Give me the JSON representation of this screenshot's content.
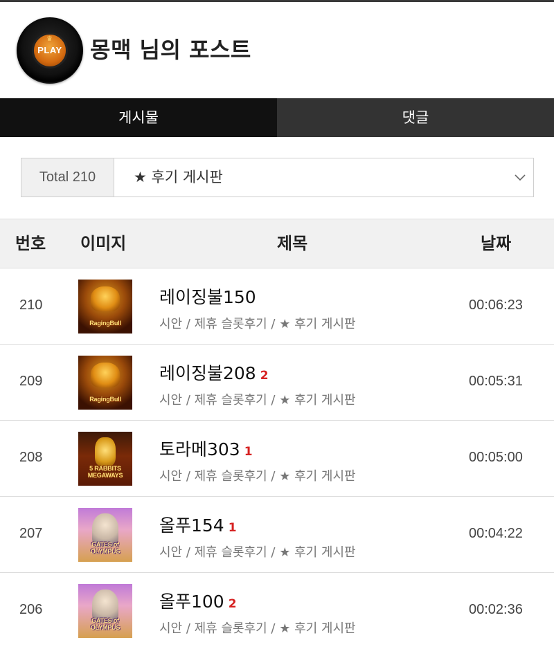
{
  "header": {
    "avatar_text": "PLAY",
    "title": "몽맥 님의 포스트"
  },
  "tabs": [
    {
      "label": "게시물",
      "active": true
    },
    {
      "label": "댓글",
      "active": false
    }
  ],
  "filter": {
    "total_label": "Total 210",
    "selected_board": "★ 후기 게시판"
  },
  "table": {
    "headers": {
      "number": "번호",
      "image": "이미지",
      "title": "제목",
      "date": "날짜"
    },
    "rows": [
      {
        "number": "210",
        "thumb": "raging-bull",
        "thumb_label": "RagingBull",
        "title": "레이징불150",
        "comments": "",
        "meta": "시안 / 제휴 슬롯후기 / ★ 후기 게시판",
        "date": "00:06:23"
      },
      {
        "number": "209",
        "thumb": "raging-bull",
        "thumb_label": "RagingBull",
        "title": "레이징불208",
        "comments": "2",
        "meta": "시안 / 제휴 슬롯후기 / ★ 후기 게시판",
        "date": "00:05:31"
      },
      {
        "number": "208",
        "thumb": "5-rabbits",
        "thumb_label": "5 RABBITS MEGAWAYS",
        "title": "토라메303",
        "comments": "1",
        "meta": "시안 / 제휴 슬롯후기 / ★ 후기 게시판",
        "date": "00:05:00"
      },
      {
        "number": "207",
        "thumb": "gates-of-olympus",
        "thumb_label": "GATES of OLYMPUS",
        "title": "올푸154",
        "comments": "1",
        "meta": "시안 / 제휴 슬롯후기 / ★ 후기 게시판",
        "date": "00:04:22"
      },
      {
        "number": "206",
        "thumb": "gates-of-olympus",
        "thumb_label": "GATES of OLYMPUS",
        "title": "올푸100",
        "comments": "2",
        "meta": "시안 / 제휴 슬롯후기 / ★ 후기 게시판",
        "date": "00:02:36"
      }
    ]
  },
  "colors": {
    "tab_active": "#111111",
    "tab_inactive": "#333333",
    "comment_count": "#d62222",
    "header_row_bg": "#f1f1f1"
  },
  "icons": {
    "dropdown": "chevron-down-icon"
  }
}
